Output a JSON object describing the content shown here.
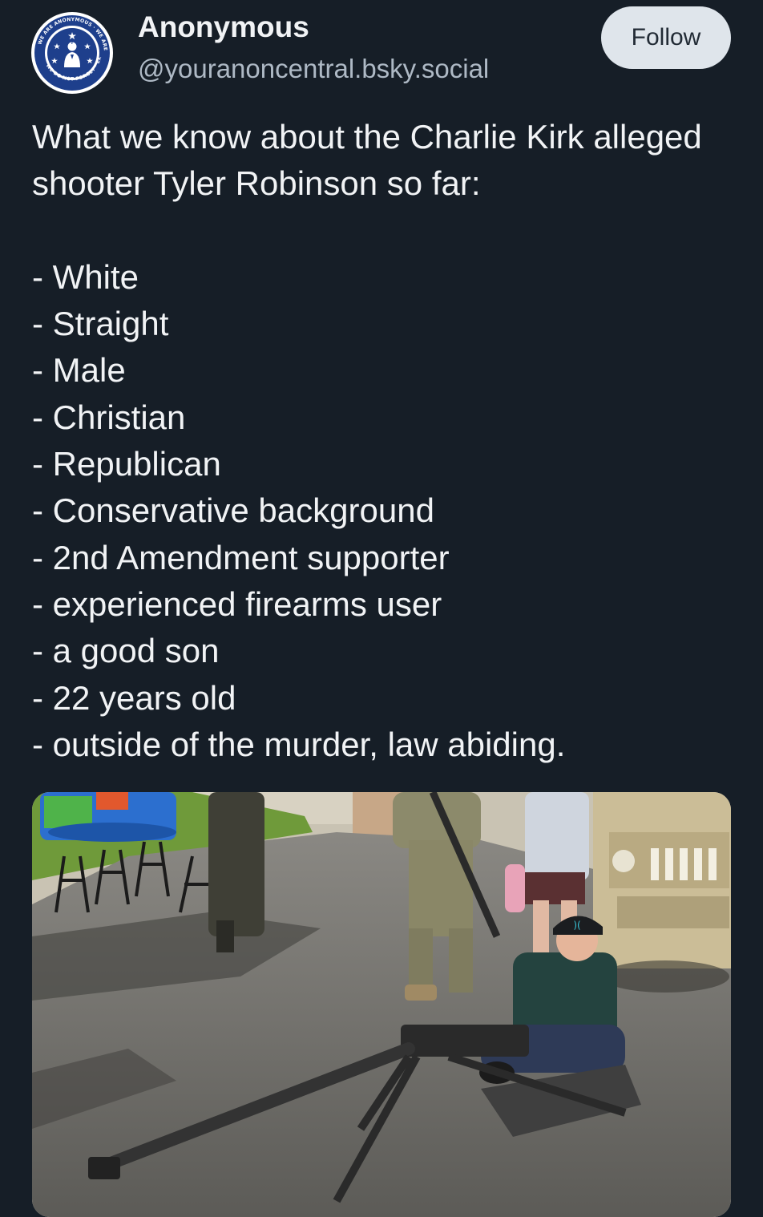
{
  "author": {
    "display_name": "Anonymous",
    "handle": "@youranoncentral.bsky.social",
    "avatar_seal_top_text": "WE ARE ANONYMOUS · WE ARE LEGION · WE DO NOT FORGIVE",
    "avatar_seal_bottom_text": "WE DO NOT FORGET · EXPECT US",
    "avatar_seal_left_text": "KNOWLEDGE IS FREE"
  },
  "follow_button": {
    "label": "Follow"
  },
  "post": {
    "intro": "What we know about the Charlie Kirk alleged shooter Tyler Robinson so far:",
    "items": [
      "- White",
      "- Straight",
      "- Male",
      "- Christian",
      "- Republican",
      "- Conservative background",
      "- 2nd Amendment supporter",
      "- experienced firearms user",
      "- a good son",
      "- 22 years old",
      "- outside of the murder, law abiding."
    ]
  },
  "icons": {
    "avatar": "anonymous-seal-icon",
    "cap_logo": "hurley-logo-icon"
  },
  "colors": {
    "background": "#161e27",
    "text_primary": "#f1f3f5",
    "text_secondary": "#aeb9c5",
    "follow_bg": "#dfe5eb",
    "follow_text": "#222b35"
  }
}
